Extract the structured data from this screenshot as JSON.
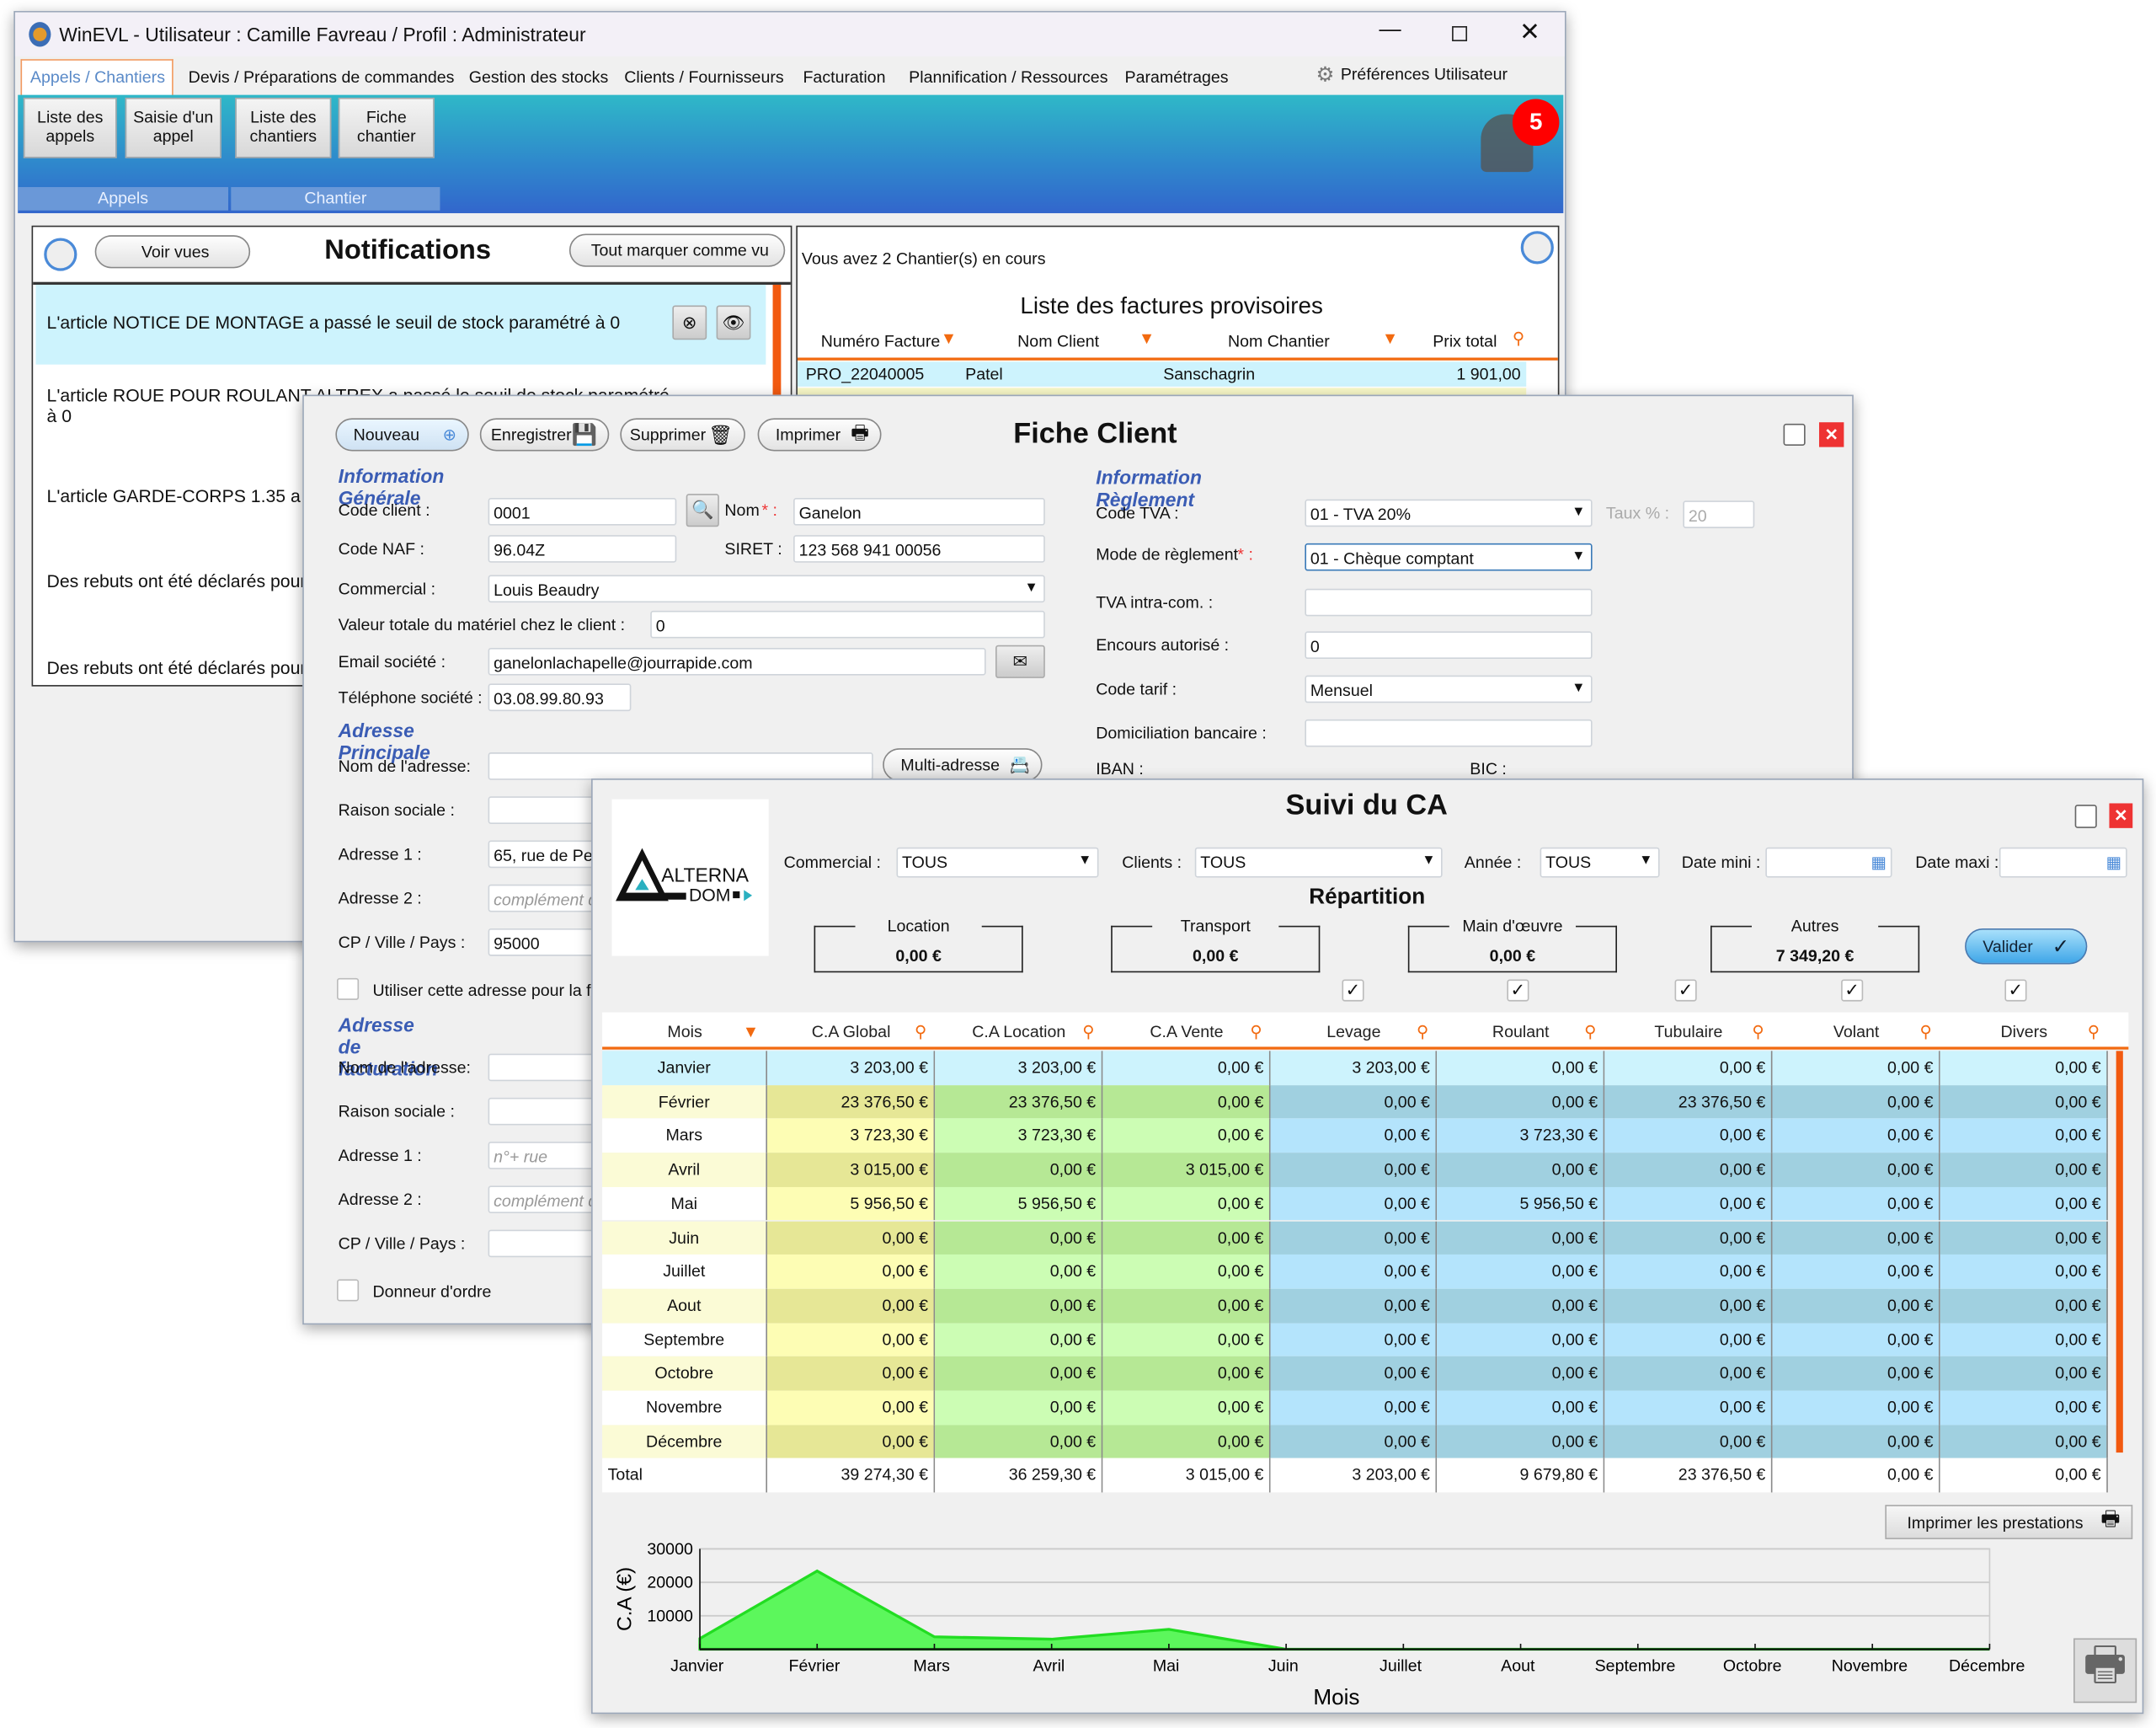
{
  "main_window": {
    "title": "WinEVL  - Utilisateur : Camille Favreau / Profil : Administrateur",
    "tabs": [
      {
        "label": "Appels / Chantiers",
        "active": true
      },
      {
        "label": "Devis / Préparations de commandes"
      },
      {
        "label": "Gestion des stocks"
      },
      {
        "label": "Clients / Fournisseurs"
      },
      {
        "label": "Facturation"
      },
      {
        "label": "Plannification / Ressources"
      },
      {
        "label": "Paramétrages"
      }
    ],
    "preferences": "Préférences Utilisateur",
    "ribbon": {
      "buttons": [
        {
          "l1": "Liste des",
          "l2": "appels"
        },
        {
          "l1": "Saisie d'un",
          "l2": "appel"
        },
        {
          "l1": "Liste des",
          "l2": "chantiers"
        },
        {
          "l1": "Fiche",
          "l2": "chantier"
        }
      ],
      "groups": [
        "Appels",
        "Chantier"
      ]
    },
    "notification_count": "5",
    "notifications": {
      "title": "Notifications",
      "voir_vues": "Voir vues",
      "mark_all": "Tout marquer comme vu",
      "items": [
        "L'article NOTICE DE MONTAGE a passé le seuil de stock paramétré à 0",
        "L'article ROUE POUR ROULANT ALTREX a passé le seuil de stock paramétré à 0",
        "L'article GARDE-CORPS 1.35 a",
        "Des rebuts ont été déclarés pour",
        "Des rebuts ont été déclarés pour"
      ]
    },
    "chantiers_status": "Vous avez 2 Chantier(s) en cours",
    "factures": {
      "title": "Liste des factures provisoires",
      "columns": [
        "Numéro Facture",
        "Nom Client",
        "Nom Chantier",
        "Prix total"
      ],
      "rows": [
        [
          "PRO_22040005",
          "Patel",
          "Sanschagrin",
          "1 901,00"
        ]
      ]
    }
  },
  "fiche_client": {
    "title": "Fiche Client",
    "buttons": {
      "nouveau": "Nouveau",
      "enregistrer": "Enregistrer",
      "supprimer": "Supprimer",
      "imprimer": "Imprimer"
    },
    "info_generale": "Information Générale",
    "code_client_label": "Code client :",
    "code_client": "0001",
    "nom_label": "Nom",
    "nom": "Ganelon",
    "code_naf_label": "Code NAF :",
    "code_naf": "96.04Z",
    "siret_label": "SIRET :",
    "siret": "123 568 941 00056",
    "commercial_label": "Commercial :",
    "commercial": "Louis  Beaudry",
    "valeur_label": "Valeur totale du matériel chez le client :",
    "valeur": "0",
    "email_label": "Email société :",
    "email": "ganelonlachapelle@jourrapide.com",
    "tel_label": "Téléphone société :",
    "tel": "03.08.99.80.93",
    "adresse_principale": "Adresse Principale",
    "nom_adresse_label": "Nom de l'adresse:",
    "multi_adresse": "Multi-adresse",
    "raison_label": "Raison sociale :",
    "adresse1_label": "Adresse 1 :",
    "adresse1": "65, rue de Pe",
    "adresse2_label": "Adresse 2 :",
    "adresse2_ph": "complément d",
    "cp_label": "CP / Ville / Pays :",
    "cp": "95000",
    "use_address": "Utiliser cette adresse pour la fa",
    "adresse_facturation": "Adresse de facturation",
    "f_adresse1_ph": "n°+ rue",
    "donneur": "Donneur d'ordre",
    "info_reglement": "Information Règlement",
    "code_tva_label": "Code TVA :",
    "code_tva": "01 - TVA 20%",
    "taux_label": "Taux % :",
    "taux": "20",
    "mode_label": "Mode de règlement",
    "mode": "01 - Chèque comptant",
    "tva_intra_label": "TVA intra-com. :",
    "encours_label": "Encours autorisé :",
    "encours": "0",
    "code_tarif_label": "Code tarif :",
    "code_tarif": "Mensuel",
    "domiciliation_label": "Domiciliation bancaire :",
    "iban_label": "IBAN :",
    "bic_label": "BIC :"
  },
  "suivi_ca": {
    "title": "Suivi du CA",
    "logo": "ALTERNA DOM",
    "filters": {
      "commercial_label": "Commercial :",
      "commercial": "TOUS",
      "clients_label": "Clients :",
      "clients": "TOUS",
      "annee_label": "Année :",
      "annee": "TOUS",
      "date_mini_label": "Date mini :",
      "date_maxi_label": "Date maxi :"
    },
    "repartition": "Répartition",
    "boxes": [
      {
        "label": "Location",
        "value": "0,00 €"
      },
      {
        "label": "Transport",
        "value": "0,00 €"
      },
      {
        "label": "Main d'œuvre",
        "value": "0,00 €"
      },
      {
        "label": "Autres",
        "value": "7 349,20 €"
      }
    ],
    "valider": "Valider",
    "columns": [
      "Mois",
      "C.A Global",
      "C.A Location",
      "C.A Vente",
      "Levage",
      "Roulant",
      "Tubulaire",
      "Volant",
      "Divers"
    ],
    "rows": [
      [
        "Janvier",
        "3 203,00 €",
        "3 203,00 €",
        "0,00 €",
        "3 203,00 €",
        "0,00 €",
        "0,00 €",
        "0,00 €",
        "0,00 €"
      ],
      [
        "Février",
        "23 376,50 €",
        "23 376,50 €",
        "0,00 €",
        "0,00 €",
        "0,00 €",
        "23 376,50 €",
        "0,00 €",
        "0,00 €"
      ],
      [
        "Mars",
        "3 723,30 €",
        "3 723,30 €",
        "0,00 €",
        "0,00 €",
        "3 723,30 €",
        "0,00 €",
        "0,00 €",
        "0,00 €"
      ],
      [
        "Avril",
        "3 015,00 €",
        "0,00 €",
        "3 015,00 €",
        "0,00 €",
        "0,00 €",
        "0,00 €",
        "0,00 €",
        "0,00 €"
      ],
      [
        "Mai",
        "5 956,50 €",
        "5 956,50 €",
        "0,00 €",
        "0,00 €",
        "5 956,50 €",
        "0,00 €",
        "0,00 €",
        "0,00 €"
      ],
      [
        "Juin",
        "0,00 €",
        "0,00 €",
        "0,00 €",
        "0,00 €",
        "0,00 €",
        "0,00 €",
        "0,00 €",
        "0,00 €"
      ],
      [
        "Juillet",
        "0,00 €",
        "0,00 €",
        "0,00 €",
        "0,00 €",
        "0,00 €",
        "0,00 €",
        "0,00 €",
        "0,00 €"
      ],
      [
        "Aout",
        "0,00 €",
        "0,00 €",
        "0,00 €",
        "0,00 €",
        "0,00 €",
        "0,00 €",
        "0,00 €",
        "0,00 €"
      ],
      [
        "Septembre",
        "0,00 €",
        "0,00 €",
        "0,00 €",
        "0,00 €",
        "0,00 €",
        "0,00 €",
        "0,00 €",
        "0,00 €"
      ],
      [
        "Octobre",
        "0,00 €",
        "0,00 €",
        "0,00 €",
        "0,00 €",
        "0,00 €",
        "0,00 €",
        "0,00 €",
        "0,00 €"
      ],
      [
        "Novembre",
        "0,00 €",
        "0,00 €",
        "0,00 €",
        "0,00 €",
        "0,00 €",
        "0,00 €",
        "0,00 €",
        "0,00 €"
      ],
      [
        "Décembre",
        "0,00 €",
        "0,00 €",
        "0,00 €",
        "0,00 €",
        "0,00 €",
        "0,00 €",
        "0,00 €",
        "0,00 €"
      ]
    ],
    "total": [
      "Total",
      "39 274,30 €",
      "36 259,30 €",
      "3 015,00 €",
      "3 203,00 €",
      "9 679,80 €",
      "23 376,50 €",
      "0,00 €",
      "0,00 €"
    ],
    "imprimer_prestations": "Imprimer les prestations"
  },
  "chart_data": {
    "type": "area",
    "categories": [
      "Janvier",
      "Février",
      "Mars",
      "Avril",
      "Mai",
      "Juin",
      "Juillet",
      "Aout",
      "Septembre",
      "Octobre",
      "Novembre",
      "Décembre"
    ],
    "values": [
      3203,
      23376.5,
      3723.3,
      3015,
      5956.5,
      0,
      0,
      0,
      0,
      0,
      0,
      0
    ],
    "xlabel": "Mois",
    "ylabel": "C.A (€)",
    "ylim": [
      0,
      30000
    ],
    "yticks": [
      10000,
      20000,
      30000
    ],
    "grid": true,
    "color": "#5cf75c"
  },
  "colors": {
    "accent": "#f26a10",
    "selected_row": "#cdf3fd",
    "ribbon_top": "#2fb8c8",
    "ribbon_bottom": "#3266cc",
    "section": "#3a5cb4"
  }
}
